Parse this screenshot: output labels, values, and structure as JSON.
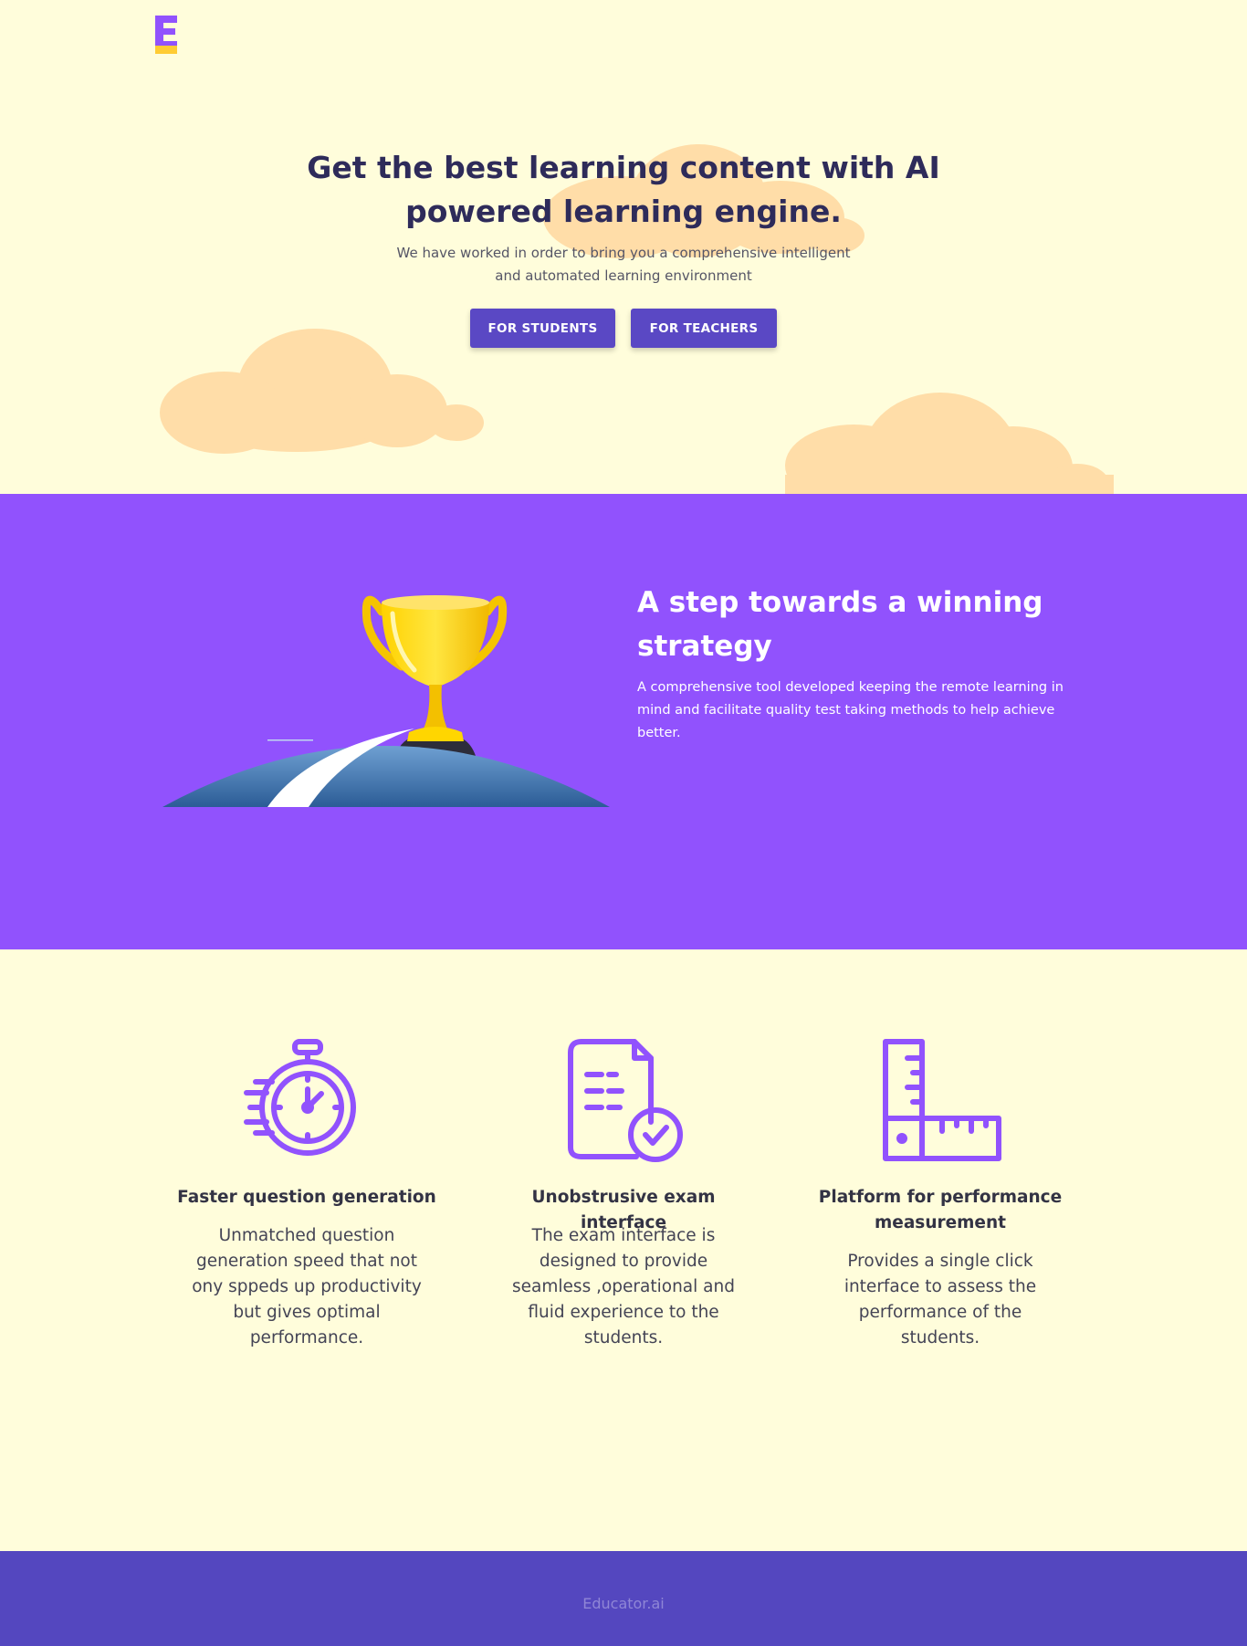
{
  "brand": {
    "logo_letter": "E",
    "logo_colors": {
      "top": "#9152fd",
      "bottom": "#ffcc33"
    }
  },
  "hero": {
    "title": "Get the best learning content with AI powered learning engine.",
    "subtitle": "We have worked in order to bring you a comprehensive intelligent and automated learning environment",
    "buttons": {
      "students": "FOR STUDENTS",
      "teachers": "FOR TEACHERS"
    }
  },
  "strategy": {
    "title": "A step towards a winning strategy",
    "text": "A comprehensive tool developed keeping the remote learning in mind and facilitate quality test taking methods to help achieve better.",
    "illustration": "trophy-on-road-icon"
  },
  "features": [
    {
      "icon": "stopwatch-icon",
      "title": "Faster question generation",
      "text": "Unmatched question generation speed that not ony sppeds up productivity but gives optimal performance."
    },
    {
      "icon": "document-check-icon",
      "title": "Unobstrusive exam interface",
      "text": "The exam interface is designed to provide seamless ,operational and fluid experience to the students."
    },
    {
      "icon": "ruler-square-icon",
      "title": "Platform for performance measurement",
      "text": "Provides a single click interface to assess the performance of the students."
    }
  ],
  "footer": {
    "text": "Educator.ai"
  },
  "colors": {
    "background": "#fffddb",
    "purple": "#9152fd",
    "button": "#5a48c4",
    "footer": "#5447bf",
    "cloud": "#ffdda8"
  }
}
